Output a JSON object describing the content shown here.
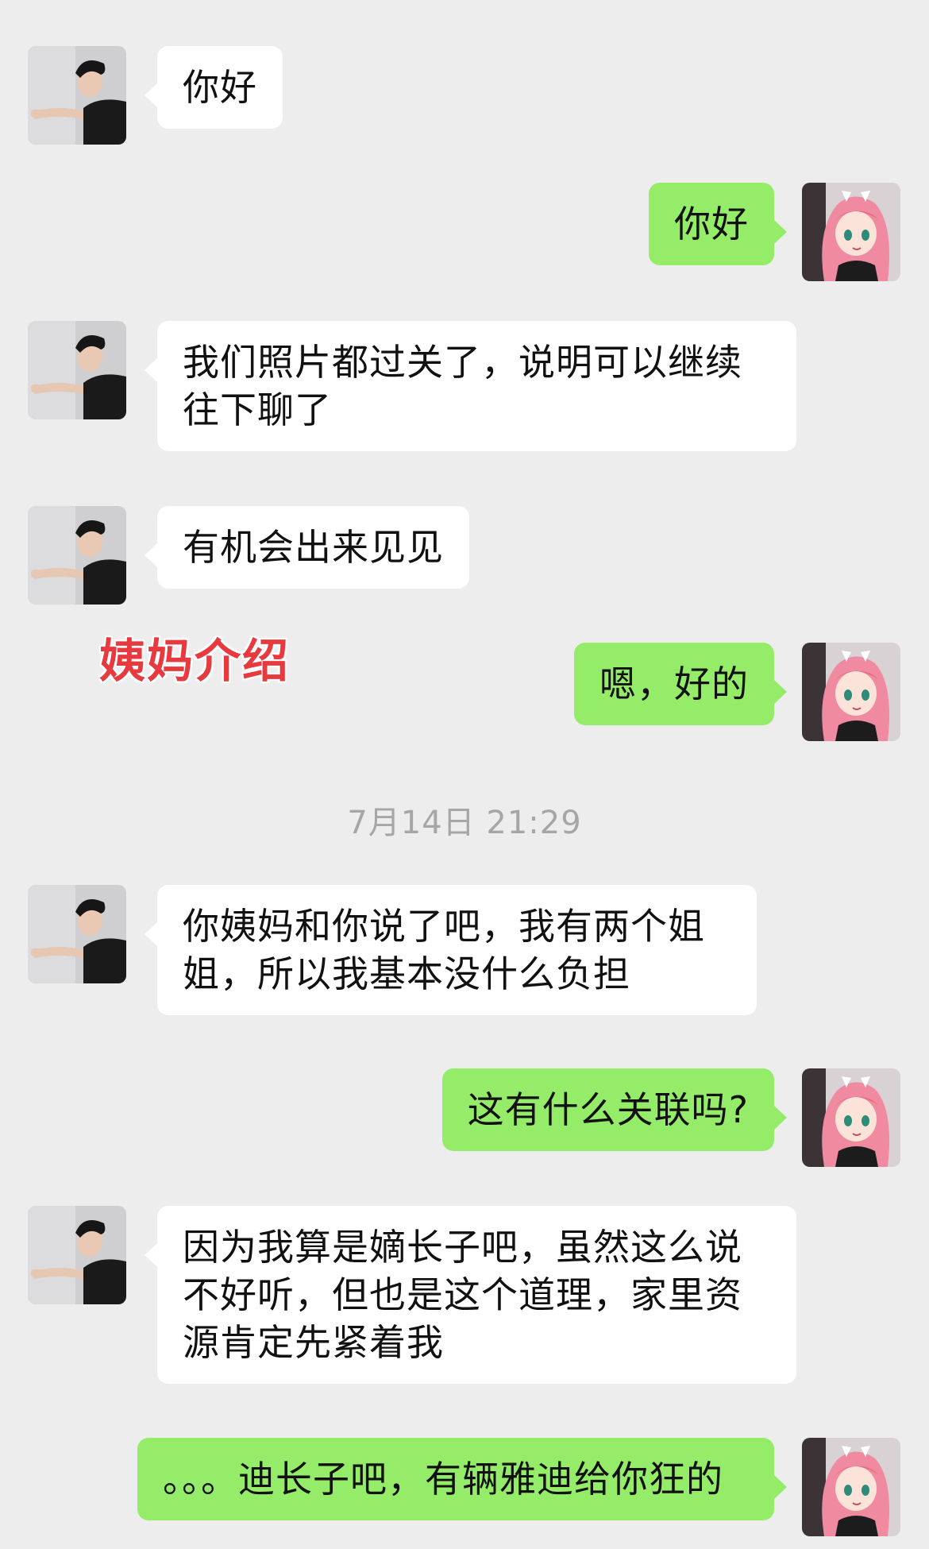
{
  "annotation": "姨妈介绍",
  "timestamp": "7月14日 21:29",
  "messages": [
    {
      "side": "left",
      "text": "你好"
    },
    {
      "side": "right",
      "text": "你好"
    },
    {
      "side": "left",
      "text": "我们照片都过关了，说明可以继续往下聊了"
    },
    {
      "side": "left",
      "text": "有机会出来见见"
    },
    {
      "side": "right",
      "text": "嗯，好的"
    },
    {
      "side": "left",
      "text": "你姨妈和你说了吧，我有两个姐姐，所以我基本没什么负担"
    },
    {
      "side": "right",
      "text": "这有什么关联吗?"
    },
    {
      "side": "left",
      "text": "因为我算是嫡长子吧，虽然这么说不好听，但也是这个道理，家里资源肯定先紧着我"
    },
    {
      "side": "right",
      "text": "。。。迪长子吧，有辆雅迪给你狂的"
    }
  ],
  "avatars": {
    "left": "male-photo-avatar",
    "right": "anime-girl-avatar"
  },
  "colors": {
    "background": "#ededed",
    "left_bubble": "#ffffff",
    "right_bubble": "#95ec69",
    "annotation": "#e8393f",
    "timestamp": "#a6a6a6"
  }
}
